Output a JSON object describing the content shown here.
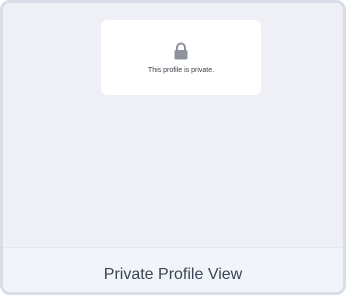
{
  "notice": {
    "icon": "lock-icon",
    "message": "This profile is private."
  },
  "footer": {
    "label": "Private Profile View"
  },
  "colors": {
    "background": "#eef0f5",
    "card_border": "#d8dde7",
    "notice_bg": "#ffffff",
    "icon": "#8e939b",
    "footer_bg": "#f1f4f9",
    "footer_text": "#3c4555"
  }
}
